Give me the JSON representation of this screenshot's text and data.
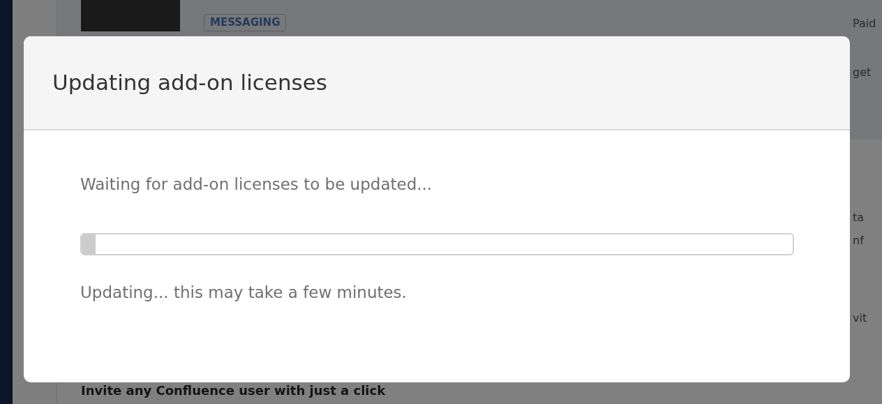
{
  "background": {
    "tag": "MESSAGING",
    "right_texts": [
      "Paid",
      "get",
      "ta",
      "nf",
      "vit"
    ],
    "feature_heading": "Invite any Confluence user with just a click"
  },
  "dialog": {
    "title": "Updating add-on licenses",
    "message": "Waiting for add-on licenses to be updated...",
    "progress": {
      "level": 0.02
    },
    "status": "Updating... this may take a few minutes."
  }
}
